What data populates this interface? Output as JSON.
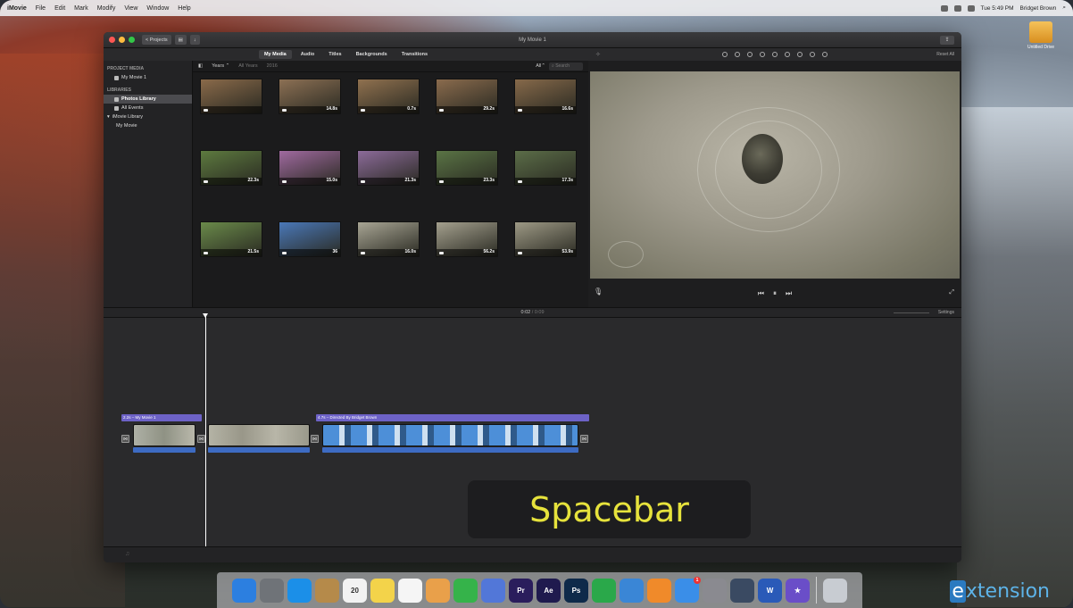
{
  "menubar": {
    "app": "iMovie",
    "items": [
      "File",
      "Edit",
      "Mark",
      "Modify",
      "View",
      "Window",
      "Help"
    ],
    "clock": "Tue 5:49 PM",
    "user": "Bridget Brown"
  },
  "desktop": {
    "drive_label": "Untitled Drive"
  },
  "window": {
    "title": "My Movie 1",
    "projects_button": "< Projects"
  },
  "tabs": [
    "My Media",
    "Audio",
    "Titles",
    "Backgrounds",
    "Transitions"
  ],
  "sidebar": {
    "project_media_header": "PROJECT MEDIA",
    "project_item": "My Movie 1",
    "libraries_header": "LIBRARIES",
    "items": [
      "Photos Library",
      "All Events",
      "iMovie Library",
      "My Movie"
    ]
  },
  "browser": {
    "years_filter": "Years",
    "all_years": "All Years",
    "year": "2016",
    "all_filter": "All",
    "search_placeholder": "Search",
    "clips": [
      {
        "duration": "",
        "color": "#8a6a4a"
      },
      {
        "duration": "14.8s",
        "color": "#8c7054"
      },
      {
        "duration": "0.7s",
        "color": "#90714f"
      },
      {
        "duration": "29.2s",
        "color": "#8a6b4d"
      },
      {
        "duration": "16.6s",
        "color": "#86694a"
      },
      {
        "duration": "22.3s",
        "color": "#5d7a3f"
      },
      {
        "duration": "15.0s",
        "color": "#a06aa0"
      },
      {
        "duration": "21.3s",
        "color": "#8c6b9a"
      },
      {
        "duration": "23.3s",
        "color": "#5a7445"
      },
      {
        "duration": "17.3s",
        "color": "#5b6d48"
      },
      {
        "duration": "21.5s",
        "color": "#6a8a4a"
      },
      {
        "duration": "36",
        "color": "#4a78b8"
      },
      {
        "duration": "16.0s",
        "color": "#a8a594"
      },
      {
        "duration": "56.2s",
        "color": "#a4a08e"
      },
      {
        "duration": "53.9s",
        "color": "#9d9985"
      }
    ]
  },
  "viewer": {
    "reset_label": "Reset All"
  },
  "timeline": {
    "current": "0:02",
    "total": "0:09",
    "settings": "Settings",
    "title_clips": [
      "2.2s – My Movie 1",
      "4.7s – Directed By Bridget Brown"
    ]
  },
  "overlay": {
    "text": "Spacebar"
  },
  "dock": [
    {
      "name": "finder",
      "color": "#2c7fe0",
      "label": ""
    },
    {
      "name": "launchpad",
      "color": "#6f7378",
      "label": ""
    },
    {
      "name": "safari",
      "color": "#1b8fe8",
      "label": ""
    },
    {
      "name": "contacts",
      "color": "#b58a4a",
      "label": ""
    },
    {
      "name": "calendar",
      "color": "#f2f2f2",
      "label": "20"
    },
    {
      "name": "notes",
      "color": "#f3d34a",
      "label": ""
    },
    {
      "name": "reminders",
      "color": "#f5f5f5",
      "label": ""
    },
    {
      "name": "photos",
      "color": "#e9a04a",
      "label": ""
    },
    {
      "name": "facetime",
      "color": "#35b34a",
      "label": ""
    },
    {
      "name": "imovie-star",
      "color": "#5277d8",
      "label": ""
    },
    {
      "name": "premiere",
      "color": "#2a1d5c",
      "label": "Pr"
    },
    {
      "name": "after-effects",
      "color": "#1f1a4e",
      "label": "Ae"
    },
    {
      "name": "photoshop",
      "color": "#0e2a4a",
      "label": "Ps"
    },
    {
      "name": "numbers",
      "color": "#2aa84a",
      "label": ""
    },
    {
      "name": "keynote",
      "color": "#3a86d6",
      "label": ""
    },
    {
      "name": "ibooks",
      "color": "#f08a2a",
      "label": ""
    },
    {
      "name": "app-store",
      "color": "#3a8ee8",
      "label": "",
      "badge": "1"
    },
    {
      "name": "system-preferences",
      "color": "#8a8a90",
      "label": ""
    },
    {
      "name": "quicktime",
      "color": "#3a4a62",
      "label": ""
    },
    {
      "name": "word",
      "color": "#2a5ab8",
      "label": "W"
    },
    {
      "name": "imovie",
      "color": "#6a4ec8",
      "label": "★"
    },
    {
      "name": "trash",
      "color": "#c8ccd2",
      "label": ""
    }
  ],
  "brand": {
    "e": "e",
    "rest": "xtension"
  }
}
